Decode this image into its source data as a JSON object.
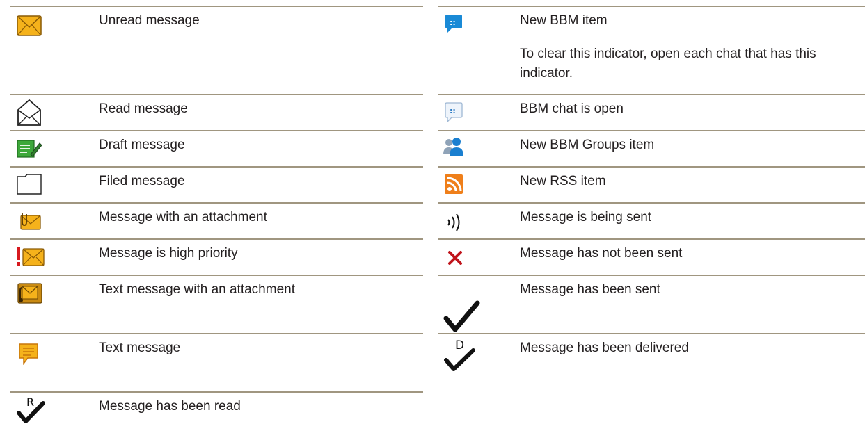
{
  "left_column": {
    "rows": [
      {
        "icon": "unread-message-icon",
        "label": "Unread message"
      },
      {
        "icon": "read-message-icon",
        "label": "Read message"
      },
      {
        "icon": "draft-message-icon",
        "label": "Draft message"
      },
      {
        "icon": "filed-message-icon",
        "label": "Filed message"
      },
      {
        "icon": "attachment-message-icon",
        "label": "Message with an attachment"
      },
      {
        "icon": "high-priority-message-icon",
        "label": "Message is high priority"
      },
      {
        "icon": "text-message-attachment-icon",
        "label": "Text message with an attachment"
      },
      {
        "icon": "text-message-icon",
        "label": "Text message"
      },
      {
        "icon": "read-receipt-icon",
        "label": "Message has been read"
      }
    ]
  },
  "right_column": {
    "rows": [
      {
        "icon": "new-bbm-item-icon",
        "label": "New BBM item",
        "note": "To clear this indicator, open each chat that has this indicator."
      },
      {
        "icon": "bbm-chat-open-icon",
        "label": "BBM chat is open"
      },
      {
        "icon": "bbm-groups-icon",
        "label": "New BBM Groups item"
      },
      {
        "icon": "rss-icon",
        "label": "New RSS item"
      },
      {
        "icon": "sending-icon",
        "label": "Message is being sent"
      },
      {
        "icon": "not-sent-icon",
        "label": "Message has not been sent"
      },
      {
        "icon": "sent-check-icon",
        "label": "Message has been sent"
      },
      {
        "icon": "delivered-icon",
        "label": "Message has been delivered"
      }
    ]
  },
  "colors": {
    "rule": "#a09680",
    "envelope": "#f5b21b",
    "envelope_stroke": "#8a5a05",
    "error_red": "#c0141b",
    "bbm_blue": "#1a8ad6",
    "draft_green": "#3da83a",
    "rss_orange": "#ef7f1a",
    "text": "#231f20"
  }
}
